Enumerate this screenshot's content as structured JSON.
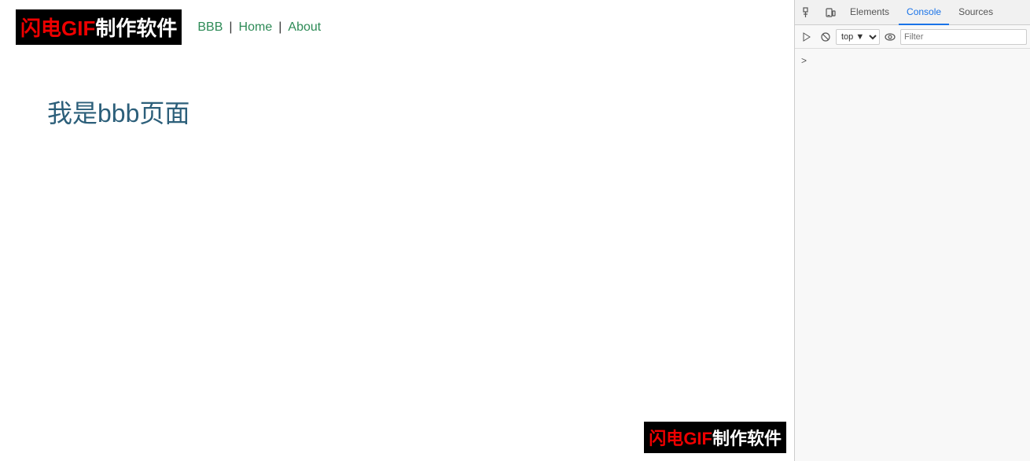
{
  "browser": {
    "logo": {
      "flash": "闪电",
      "gif": "GIF",
      "text": "制作软件"
    },
    "nav": {
      "bbb_label": "BBB",
      "home_label": "Home",
      "about_label": "About",
      "sep1": "|",
      "sep2": "|"
    },
    "page": {
      "heading": "我是bbb页面"
    },
    "watermark": {
      "flash": "闪电",
      "gif": "GIF",
      "text": "制作软件"
    }
  },
  "devtools": {
    "tabs": {
      "elements": "Elements",
      "console": "Console",
      "sources": "Sources"
    },
    "toolbar": {
      "context_selector": "top",
      "filter_placeholder": "Filter"
    },
    "console_prompt": ">"
  }
}
